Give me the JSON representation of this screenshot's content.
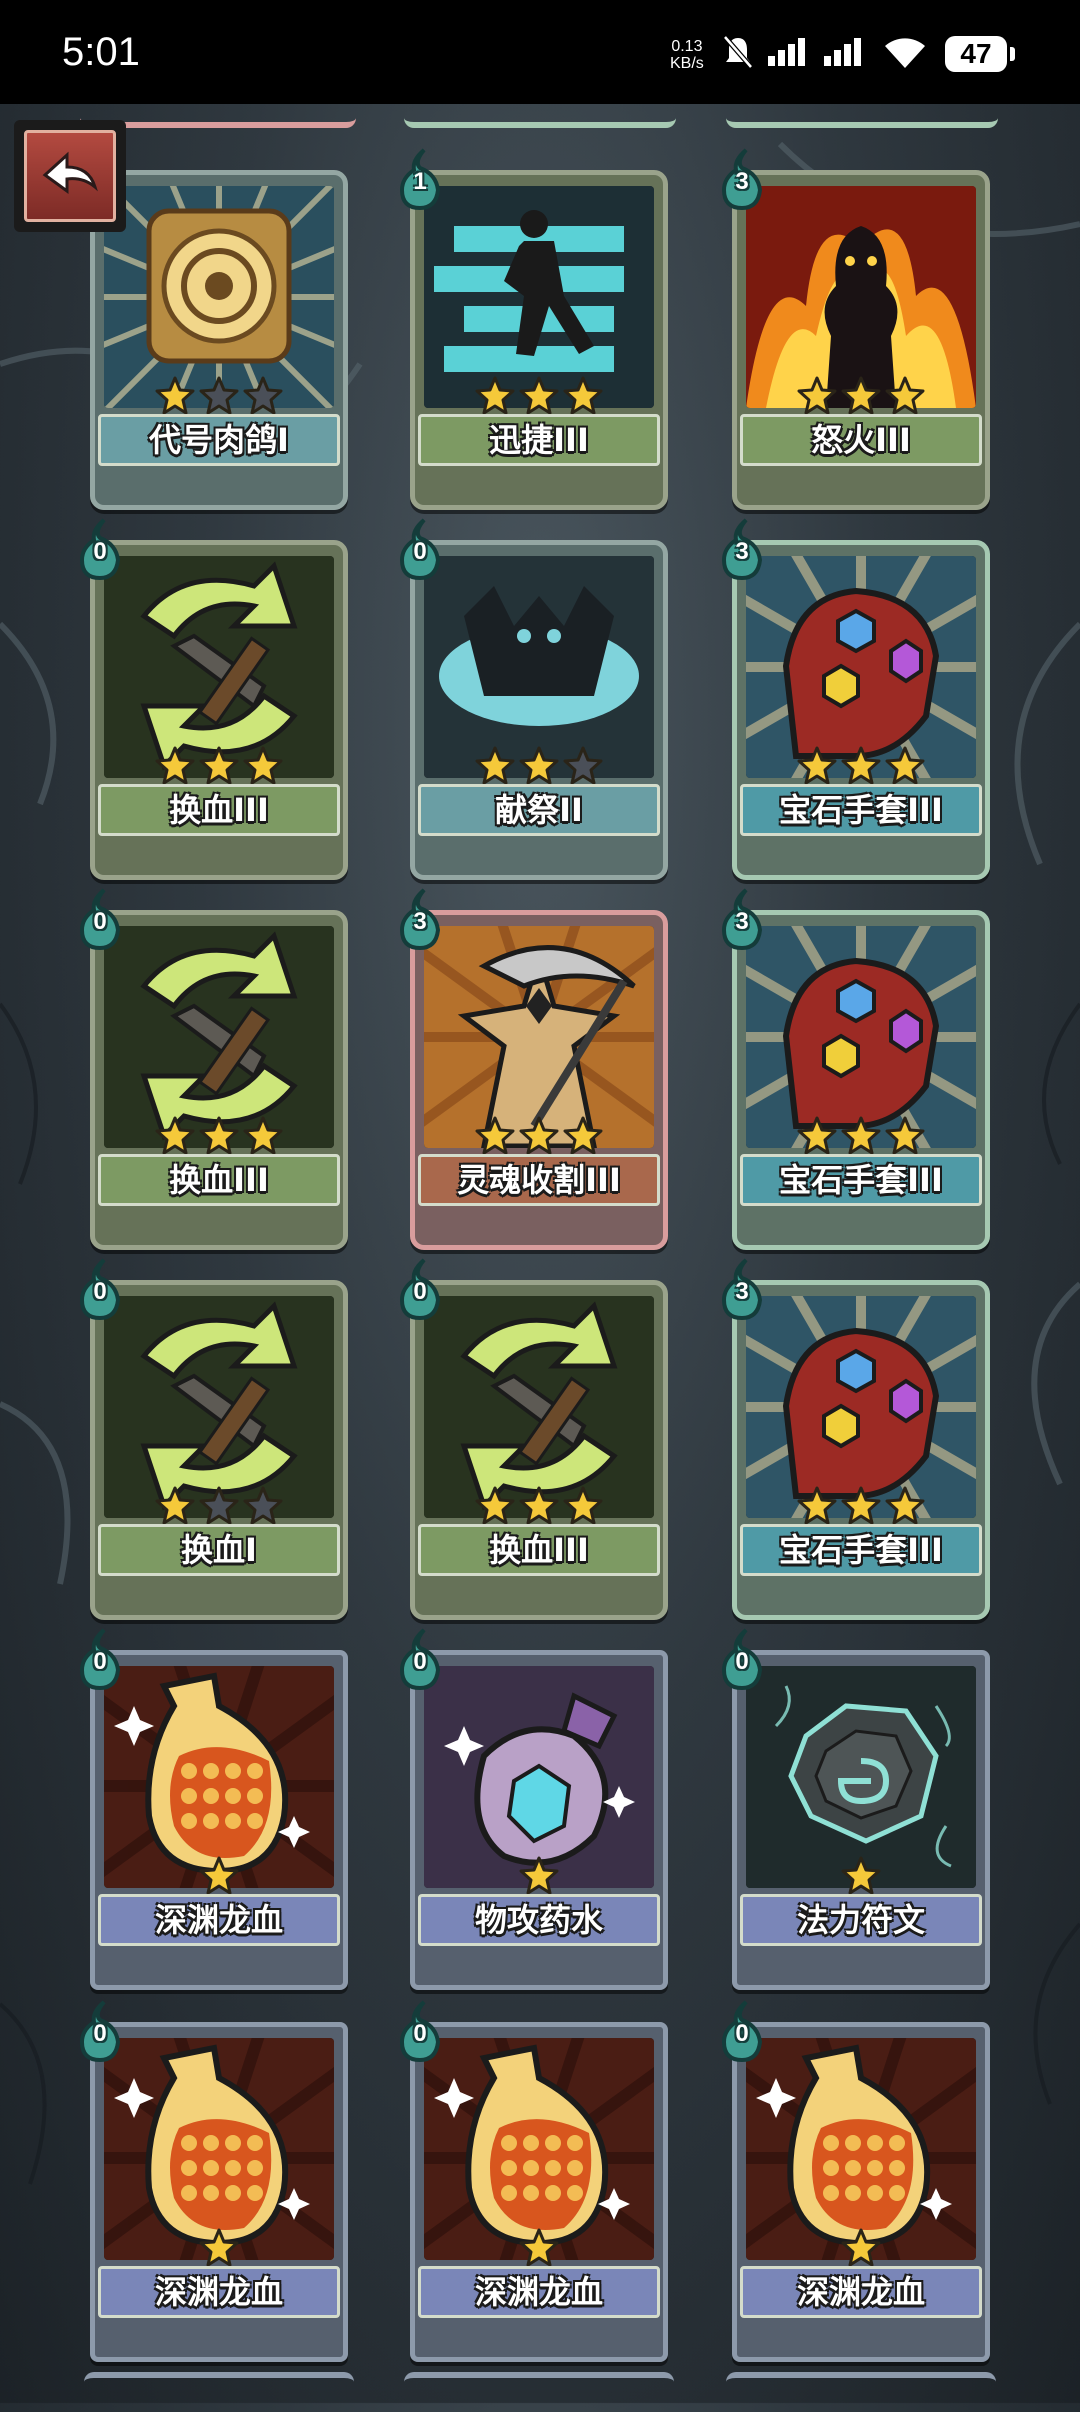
{
  "status_bar": {
    "time": "5:01",
    "net_speed_value": "0.13",
    "net_speed_unit": "KB/s",
    "battery": "47"
  },
  "back_button": {
    "icon": "back-arrow-icon"
  },
  "colors": {
    "star_filled": "#f5c93a",
    "star_empty": "#4a4f58",
    "cost_badge": "#3f9e93",
    "back_button": "#9b3a32"
  },
  "cards": [
    {
      "name": "代号肉鸽I",
      "cost": "",
      "stars": 1,
      "theme": "teal",
      "art": "target-icon"
    },
    {
      "name": "迅捷III",
      "cost": "1",
      "stars": 3,
      "theme": "green",
      "art": "running-man-icon"
    },
    {
      "name": "怒火III",
      "cost": "3",
      "stars": 3,
      "theme": "green",
      "art": "flame-silhouette-icon"
    },
    {
      "name": "换血III",
      "cost": "0",
      "stars": 3,
      "theme": "green",
      "art": "blood-swap-icon"
    },
    {
      "name": "献祭II",
      "cost": "0",
      "stars": 2,
      "theme": "teal",
      "art": "sacrifice-icon"
    },
    {
      "name": "宝石手套III",
      "cost": "3",
      "stars": 3,
      "theme": "teal2",
      "art": "gauntlet-icon"
    },
    {
      "name": "换血III",
      "cost": "0",
      "stars": 3,
      "theme": "green",
      "art": "blood-swap-icon"
    },
    {
      "name": "灵魂收割III",
      "cost": "3",
      "stars": 3,
      "theme": "pink",
      "art": "scythe-icon"
    },
    {
      "name": "宝石手套III",
      "cost": "3",
      "stars": 3,
      "theme": "teal2",
      "art": "gauntlet-icon"
    },
    {
      "name": "换血I",
      "cost": "0",
      "stars": 1,
      "theme": "green",
      "art": "blood-swap-icon"
    },
    {
      "name": "换血III",
      "cost": "0",
      "stars": 3,
      "theme": "green",
      "art": "blood-swap-icon"
    },
    {
      "name": "宝石手套III",
      "cost": "3",
      "stars": 3,
      "theme": "teal2",
      "art": "gauntlet-icon"
    },
    {
      "name": "深渊龙血",
      "cost": "0",
      "stars": 1,
      "theme": "blue",
      "art": "dragon-blood-flask-icon"
    },
    {
      "name": "物攻药水",
      "cost": "0",
      "stars": 1,
      "theme": "blue",
      "art": "crystal-potion-icon"
    },
    {
      "name": "法力符文",
      "cost": "0",
      "stars": 1,
      "theme": "blue",
      "art": "rune-stone-icon"
    },
    {
      "name": "深渊龙血",
      "cost": "0",
      "stars": 1,
      "theme": "blue",
      "art": "dragon-blood-flask-icon"
    },
    {
      "name": "深渊龙血",
      "cost": "0",
      "stars": 1,
      "theme": "blue",
      "art": "dragon-blood-flask-icon"
    },
    {
      "name": "深渊龙血",
      "cost": "0",
      "stars": 1,
      "theme": "blue",
      "art": "dragon-blood-flask-icon"
    }
  ],
  "max_stars_upgrade": 3
}
